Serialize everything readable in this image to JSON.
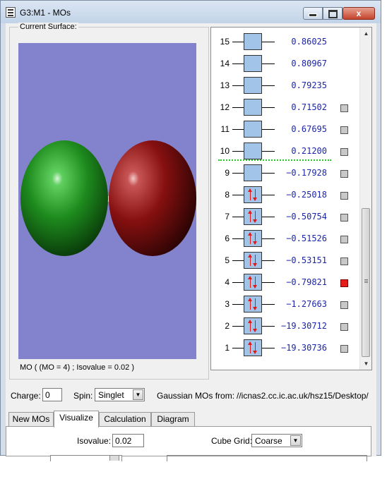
{
  "window": {
    "title": "G3:M1 - MOs",
    "min_label": "minimize",
    "max_label": "maximize",
    "close_label": "x"
  },
  "surface": {
    "group_label": "Current Surface:",
    "caption": "MO ( (MO = 4) ; Isovalue = 0.02 )",
    "colors": {
      "background": "#8283cc",
      "positive_lobe": "#1f8a1f",
      "negative_lobe": "#8a0f0f"
    }
  },
  "orbitals": [
    {
      "number": "15",
      "energy": "0.86025",
      "occupied": false,
      "has_checkbox": false,
      "selected": false
    },
    {
      "number": "14",
      "energy": "0.80967",
      "occupied": false,
      "has_checkbox": false,
      "selected": false
    },
    {
      "number": "13",
      "energy": "0.79235",
      "occupied": false,
      "has_checkbox": false,
      "selected": false
    },
    {
      "number": "12",
      "energy": "0.71502",
      "occupied": false,
      "has_checkbox": true,
      "selected": false
    },
    {
      "number": "11",
      "energy": "0.67695",
      "occupied": false,
      "has_checkbox": true,
      "selected": false
    },
    {
      "number": "10",
      "energy": "0.21200",
      "occupied": false,
      "has_checkbox": true,
      "selected": false
    },
    {
      "number": "9",
      "energy": "−0.17928",
      "occupied": false,
      "has_checkbox": true,
      "selected": false
    },
    {
      "number": "8",
      "energy": "−0.25018",
      "occupied": true,
      "has_checkbox": true,
      "selected": false
    },
    {
      "number": "7",
      "energy": "−0.50754",
      "occupied": true,
      "has_checkbox": true,
      "selected": false
    },
    {
      "number": "6",
      "energy": "−0.51526",
      "occupied": true,
      "has_checkbox": true,
      "selected": false
    },
    {
      "number": "5",
      "energy": "−0.53151",
      "occupied": true,
      "has_checkbox": true,
      "selected": false
    },
    {
      "number": "4",
      "energy": "−0.79821",
      "occupied": true,
      "has_checkbox": true,
      "selected": true
    },
    {
      "number": "3",
      "energy": "−1.27663",
      "occupied": true,
      "has_checkbox": true,
      "selected": false
    },
    {
      "number": "2",
      "energy": "−19.30712",
      "occupied": true,
      "has_checkbox": true,
      "selected": false
    },
    {
      "number": "1",
      "energy": "−19.30736",
      "occupied": true,
      "has_checkbox": true,
      "selected": false
    }
  ],
  "controls": {
    "charge_label": "Charge:",
    "charge_value": "0",
    "spin_label": "Spin:",
    "spin_value": "Singlet",
    "source_label": "Gaussian MOs from:",
    "source_path": "//icnas2.cc.ic.ac.uk/hsz15/Desktop/"
  },
  "tabs": [
    {
      "label": "New MOs",
      "active": false
    },
    {
      "label": "Visualize",
      "active": true
    },
    {
      "label": "Calculation",
      "active": false
    },
    {
      "label": "Diagram",
      "active": false
    }
  ],
  "visualize": {
    "isovalue_label": "Isovalue:",
    "isovalue_value": "0.02",
    "cube_grid_label": "Cube Grid:",
    "cube_grid_value": "Coarse"
  },
  "colors": {
    "energy_text": "#1c25a8",
    "homo_lumo_divider": "#21c821",
    "selected_checkbox": "#e81b1b",
    "orbital_box": "#a2c4e8"
  }
}
